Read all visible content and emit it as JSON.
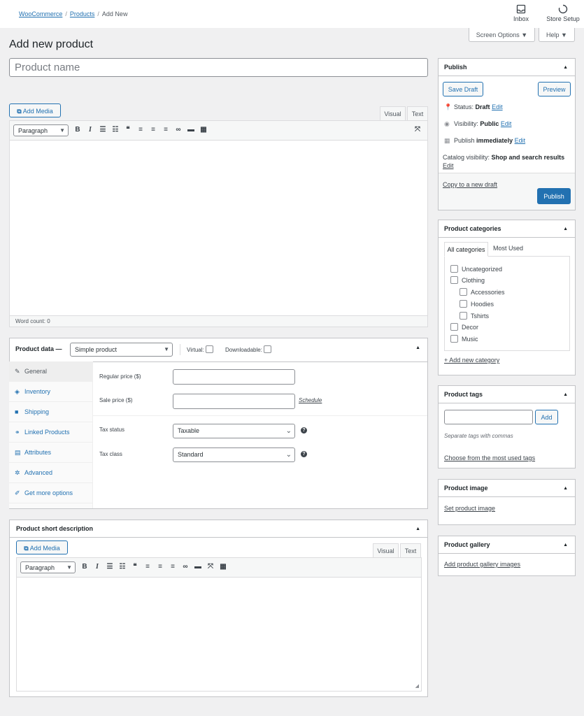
{
  "breadcrumb": {
    "root": "WooCommerce",
    "section": "Products",
    "current": "Add New"
  },
  "topbar": {
    "inbox_label": "Inbox",
    "store_setup_label": "Store Setup"
  },
  "screen_options_label": "Screen Options ▼",
  "help_label": "Help ▼",
  "page_title": "Add new product",
  "product_name": {
    "placeholder": "Product name",
    "value": ""
  },
  "main_editor": {
    "add_media_label": "Add Media",
    "visual_tab": "Visual",
    "text_tab": "Text",
    "format_select": "Paragraph",
    "word_count": "Word count: 0"
  },
  "product_data": {
    "title": "Product data —",
    "type_select": "Simple product",
    "virtual_label": "Virtual:",
    "downloadable_label": "Downloadable:",
    "nav": [
      {
        "label": "General",
        "icon": "wrench-icon",
        "glyph": "✎"
      },
      {
        "label": "Inventory",
        "icon": "tag-icon",
        "glyph": "◈"
      },
      {
        "label": "Shipping",
        "icon": "truck-icon",
        "glyph": "■"
      },
      {
        "label": "Linked Products",
        "icon": "link-icon",
        "glyph": "⚭"
      },
      {
        "label": "Attributes",
        "icon": "list-icon",
        "glyph": "▤"
      },
      {
        "label": "Advanced",
        "icon": "gear-icon",
        "glyph": "✲"
      },
      {
        "label": "Get more options",
        "icon": "plugin-icon",
        "glyph": "✐"
      }
    ],
    "regular_price_label": "Regular price ($)",
    "regular_price_value": "",
    "sale_price_label": "Sale price ($)",
    "sale_price_value": "",
    "schedule_link": "Schedule",
    "tax_status_label": "Tax status",
    "tax_status_value": "Taxable",
    "tax_class_label": "Tax class",
    "tax_class_value": "Standard"
  },
  "short_description": {
    "title": "Product short description",
    "add_media_label": "Add Media",
    "visual_tab": "Visual",
    "text_tab": "Text",
    "format_select": "Paragraph"
  },
  "publish": {
    "title": "Publish",
    "save_draft": "Save Draft",
    "preview": "Preview",
    "status_label": "Status:",
    "status_value": "Draft",
    "visibility_label": "Visibility:",
    "visibility_value": "Public",
    "publish_label": "Publish",
    "publish_value": "immediately",
    "edit_label": "Edit",
    "catalog_label": "Catalog visibility:",
    "catalog_value": "Shop and search results",
    "copy_draft": "Copy to a new draft",
    "publish_button": "Publish"
  },
  "categories": {
    "title": "Product categories",
    "tab_all": "All categories",
    "tab_most_used": "Most Used",
    "items": [
      {
        "label": "Uncategorized",
        "level": 0
      },
      {
        "label": "Clothing",
        "level": 0
      },
      {
        "label": "Accessories",
        "level": 1
      },
      {
        "label": "Hoodies",
        "level": 1
      },
      {
        "label": "Tshirts",
        "level": 1
      },
      {
        "label": "Decor",
        "level": 0
      },
      {
        "label": "Music",
        "level": 0
      }
    ],
    "add_new": "+ Add new category"
  },
  "tags": {
    "title": "Product tags",
    "input_value": "",
    "add_button": "Add",
    "hint": "Separate tags with commas",
    "choose_link": "Choose from the most used tags"
  },
  "product_image": {
    "title": "Product image",
    "link": "Set product image"
  },
  "product_gallery": {
    "title": "Product gallery",
    "link": "Add product gallery images"
  },
  "colors": {
    "accent": "#2271b1",
    "background": "#f0f0f1",
    "border": "#c3c4c7"
  }
}
